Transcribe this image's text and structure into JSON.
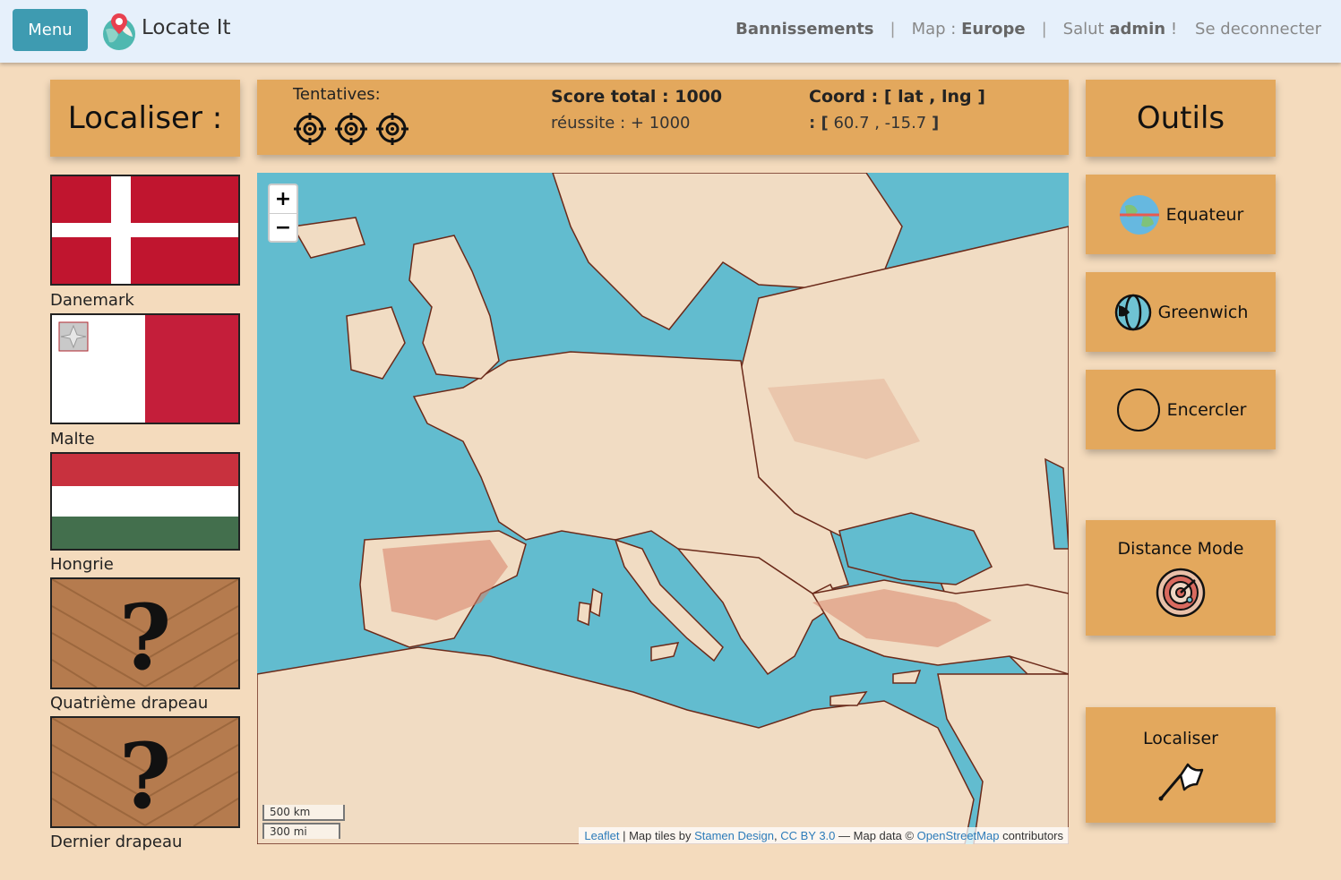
{
  "navbar": {
    "menu_label": "Menu",
    "brand": "Locate It",
    "bans": "Bannissements",
    "map_prefix": "Map :",
    "map_name": "Europe",
    "greeting": "Salut",
    "user": "admin",
    "greeting_suffix": "!",
    "logout": "Se deconnecter",
    "separator": "|"
  },
  "left_panel": {
    "title": "Localiser :",
    "flags": [
      {
        "name": "Danemark",
        "flag": "denmark"
      },
      {
        "name": "Malte",
        "flag": "malta"
      },
      {
        "name": "Hongrie",
        "flag": "hungary"
      },
      {
        "name": "Quatrième drapeau",
        "flag": "unknown"
      },
      {
        "name": "Dernier drapeau",
        "flag": "unknown"
      }
    ]
  },
  "info": {
    "attempts_label": "Tentatives:",
    "attempts_remaining": 3,
    "score_total": "Score total : 1000",
    "score_success": "réussite : + 1000",
    "coord_label": "Coord : [ lat , lng ]",
    "coord_prefix": ": [",
    "coord_value": "60.7 , -15.7",
    "coord_suffix": "]"
  },
  "map": {
    "zoom_in": "+",
    "zoom_out": "−",
    "scale_km": "500 km",
    "scale_mi": "300 mi",
    "attribution": {
      "leaflet": "Leaflet",
      "tiles_text": "| Map tiles by",
      "stamen": "Stamen Design",
      "comma": ",",
      "license": "CC BY 3.0",
      "data_text": "— Map data ©",
      "osm": "OpenStreetMap",
      "contributors": "contributors"
    }
  },
  "tools": {
    "title": "Outils",
    "equator": "Equateur",
    "greenwich": "Greenwich",
    "circle": "Encercler",
    "distance_mode": "Distance Mode",
    "locate": "Localiser"
  },
  "colors": {
    "accent": "#3e9bb1",
    "card": "#e3a85d",
    "background": "#f4dbbd",
    "navbar": "#e6f0fb",
    "sea": "#62bccf",
    "land": "#f1dcc3"
  }
}
